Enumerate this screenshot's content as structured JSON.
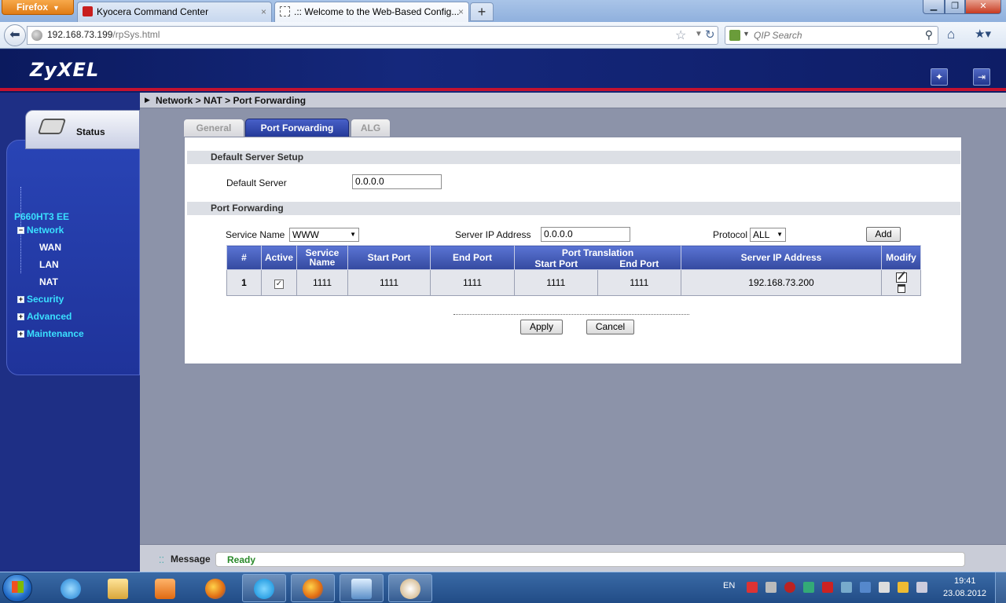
{
  "browser": {
    "menu_label": "Firefox",
    "tabs": [
      {
        "label": "Kyocera Command Center",
        "active": false
      },
      {
        "label": ".:: Welcome to the Web-Based Config...",
        "active": true
      }
    ],
    "new_tab": "+",
    "url_host": "192.168.73.199",
    "url_path": "/rpSys.html",
    "search_placeholder": "QIP Search",
    "colors": {
      "firefox_menu": "#e07b14",
      "close_button": "#c73a20"
    }
  },
  "router": {
    "logo": "ZyXEL",
    "status_label": "Status",
    "model": "P660HT3 EE",
    "menu": [
      {
        "label": "Network",
        "toggle": "−"
      },
      {
        "label": "Security",
        "toggle": "+"
      },
      {
        "label": "Advanced",
        "toggle": "+"
      },
      {
        "label": "Maintenance",
        "toggle": "+"
      }
    ],
    "network_sub": [
      "WAN",
      "LAN",
      "NAT"
    ],
    "breadcrumb": "Network > NAT > Port Forwarding",
    "tabs": [
      "General",
      "Port Forwarding",
      "ALG"
    ],
    "active_tab": "Port Forwarding",
    "default_server_section": "Default Server Setup",
    "default_server_label": "Default Server",
    "default_server_value": "0.0.0.0",
    "port_forwarding_section": "Port Forwarding",
    "service_name_label": "Service Name",
    "service_name_value": "WWW",
    "server_ip_label": "Server IP Address",
    "server_ip_value": "0.0.0.0",
    "protocol_label": "Protocol",
    "protocol_value": "ALL",
    "add_button": "Add",
    "table": {
      "headers": {
        "num": "#",
        "active": "Active",
        "service_name_1": "Service",
        "service_name_2": "Name",
        "start_port": "Start Port",
        "end_port": "End Port",
        "port_translation": "Port Translation",
        "pt_start": "Start Port",
        "pt_end": "End Port",
        "server_ip": "Server IP Address",
        "modify": "Modify"
      },
      "rows": [
        {
          "num": "1",
          "active": "✓",
          "service_name": "1111",
          "start_port": "1111",
          "end_port": "1111",
          "pt_start": "1111",
          "pt_end": "1111",
          "server_ip": "192.168.73.200"
        }
      ]
    },
    "apply_button": "Apply",
    "cancel_button": "Cancel",
    "message_label": "Message",
    "message_value": "Ready",
    "colors": {
      "banner": "#15287c",
      "accent_stripe": "#c4122f",
      "menu_text": "#3ae0ff",
      "active_tab": "#3a50b0",
      "ready": "#2a8a2a"
    }
  },
  "taskbar": {
    "language": "EN",
    "time": "19:41",
    "date": "23.08.2012"
  }
}
